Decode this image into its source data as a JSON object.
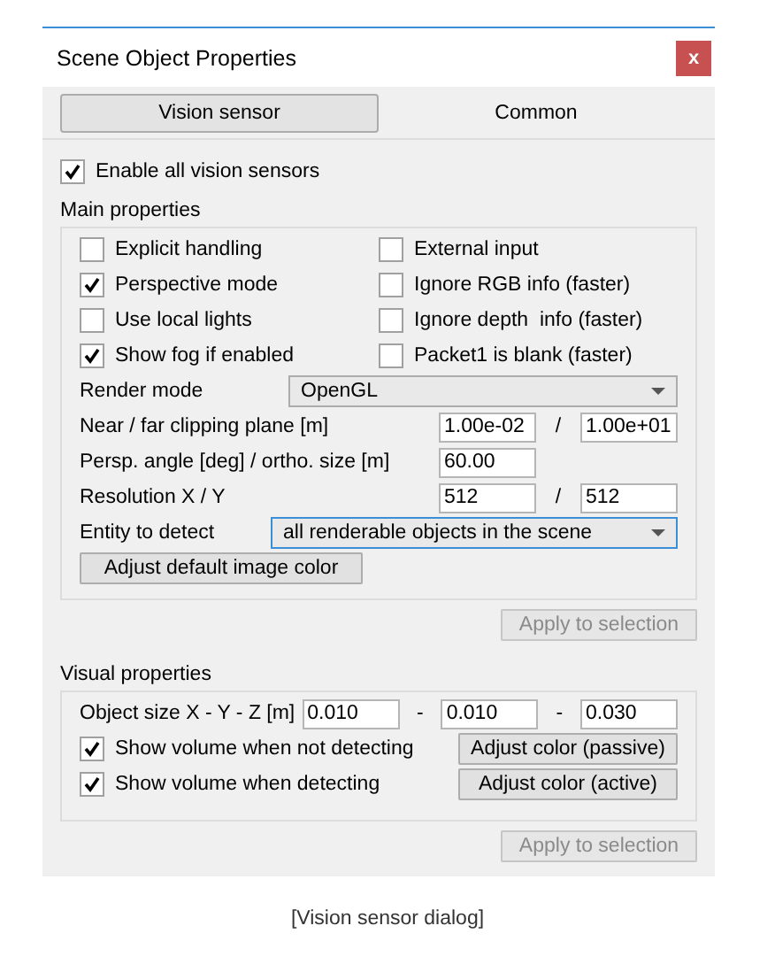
{
  "window": {
    "title": "Scene Object Properties",
    "close_label": "x"
  },
  "tabs": [
    {
      "label": "Vision sensor",
      "selected": true
    },
    {
      "label": "Common",
      "selected": false
    }
  ],
  "enable_all": {
    "label": "Enable all vision sensors",
    "checked": true
  },
  "main_properties": {
    "title": "Main properties",
    "options": [
      {
        "label": "Explicit handling",
        "checked": false
      },
      {
        "label": "External input",
        "checked": false
      },
      {
        "label": "Perspective mode",
        "checked": true
      },
      {
        "label": "Ignore RGB info (faster)",
        "checked": false
      },
      {
        "label": "Use local lights",
        "checked": false
      },
      {
        "label": "Ignore depth  info (faster)",
        "checked": false
      },
      {
        "label": "Show fog if enabled",
        "checked": true
      },
      {
        "label": "Packet1 is blank (faster)",
        "checked": false
      }
    ],
    "fields": [
      {
        "kind": "dropdown",
        "label": "Render mode",
        "value": "OpenGL",
        "focused": false
      },
      {
        "kind": "pair",
        "label": "Near / far clipping plane [m]",
        "values": [
          "1.00e-02",
          "1.00e+01"
        ],
        "separator": "/"
      },
      {
        "kind": "single",
        "label": "Persp. angle [deg] / ortho. size [m]",
        "values": [
          "60.00"
        ]
      },
      {
        "kind": "pair",
        "label": "Resolution X / Y",
        "values": [
          "512",
          "512"
        ],
        "separator": "/"
      },
      {
        "kind": "wide-dropdown",
        "label": "Entity to detect",
        "value": "all renderable objects in the scene",
        "focused": true
      }
    ],
    "adjust_button": "Adjust default image color",
    "apply_button": {
      "label": "Apply to selection",
      "disabled": true
    }
  },
  "visual_properties": {
    "title": "Visual properties",
    "size_label": "Object size X - Y - Z [m]",
    "size_values": [
      "0.010",
      "0.010",
      "0.030"
    ],
    "size_separators": [
      "-",
      "-"
    ],
    "rows": [
      {
        "label": "Show volume when not detecting",
        "checked": true,
        "button": "Adjust color (passive)"
      },
      {
        "label": "Show volume when detecting",
        "checked": true,
        "button": "Adjust color (active)"
      }
    ],
    "apply_button": {
      "label": "Apply to selection",
      "disabled": true
    }
  },
  "caption": "[Vision sensor dialog]"
}
